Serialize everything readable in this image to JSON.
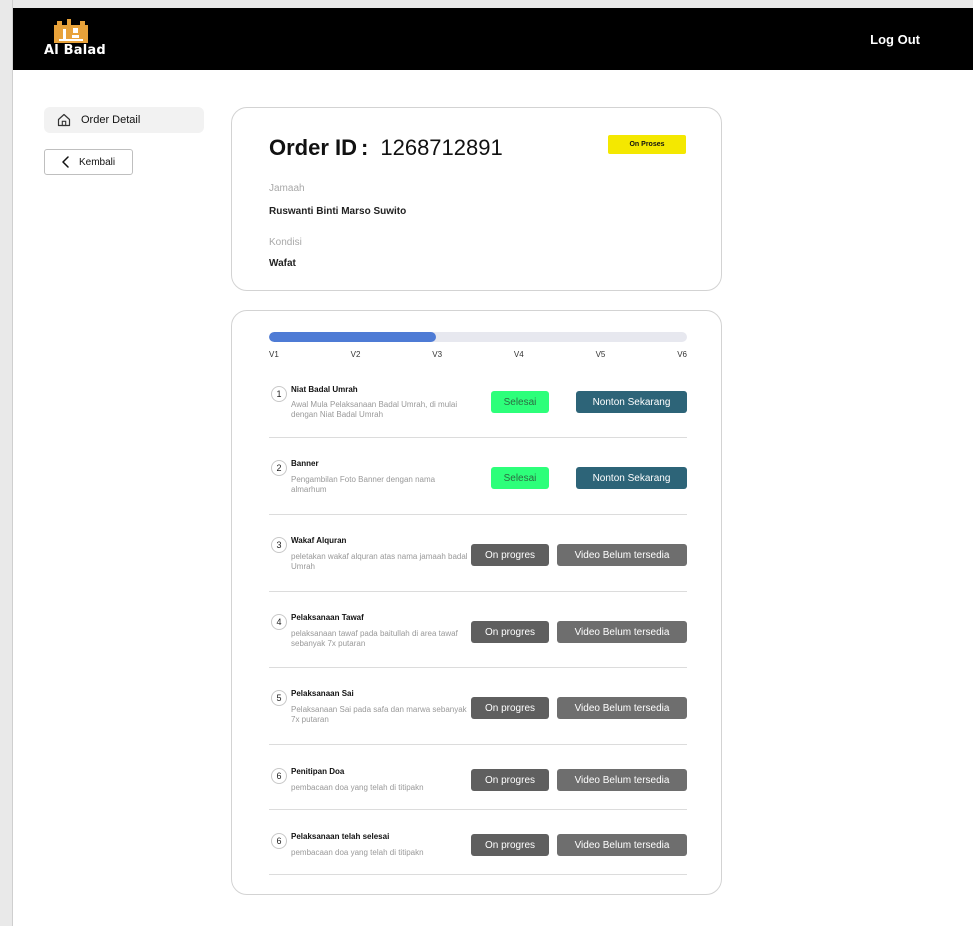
{
  "header": {
    "brand": "Al Balad",
    "logout_label": "Log Out"
  },
  "sidebar": {
    "active_item": {
      "label": "Order Detail",
      "icon": "home-icon"
    },
    "back_button": {
      "label": "Kembali",
      "icon": "chevron-left-icon"
    }
  },
  "order": {
    "id_label": "Order ID",
    "id_value": "1268712891",
    "status": "On Proses",
    "jamaah_label": "Jamaah",
    "jamaah_value": "Ruswanti Binti Marso Suwito",
    "kondisi_label": "Kondisi",
    "kondisi_value": "Wafat"
  },
  "progress": {
    "fraction": 0.4,
    "ticks": [
      "V1",
      "V2",
      "V3",
      "V4",
      "V5",
      "V6"
    ]
  },
  "colors": {
    "status_badge": "#f4e800",
    "done": "#2dff7a",
    "watch": "#2d6478",
    "in_progress": "#5f5f5f",
    "progress_fill": "#4e7bd5"
  },
  "steps": [
    {
      "num": "1",
      "title": "Niat Badal Umrah",
      "desc": "Awal Mula Pelaksanaan Badal Umrah, di mulai dengan Niat Badal Umrah",
      "status": "Selesai",
      "video": "Nonton Sekarang"
    },
    {
      "num": "2",
      "title": "Banner",
      "desc": "Pengambilan Foto Banner dengan nama almarhum",
      "status": "Selesai",
      "video": "Nonton Sekarang"
    },
    {
      "num": "3",
      "title": "Wakaf Alquran",
      "desc": "peletakan wakaf alquran atas nama jamaah badal Umrah",
      "status": "On progres",
      "video": "Video Belum tersedia"
    },
    {
      "num": "4",
      "title": "Pelaksanaan Tawaf",
      "desc": "pelaksanaan tawaf pada baitullah di area tawaf sebanyak 7x putaran",
      "status": "On progres",
      "video": "Video Belum tersedia"
    },
    {
      "num": "5",
      "title": "Pelaksanaan Sai",
      "desc": "Pelaksanaan Sai pada safa dan marwa sebanyak 7x putaran",
      "status": "On progres",
      "video": "Video Belum tersedia"
    },
    {
      "num": "6",
      "title": "Penitipan Doa",
      "desc": "pembacaan doa yang telah di titipakn",
      "status": "On progres",
      "video": "Video Belum tersedia"
    },
    {
      "num": "6",
      "title": "Pelaksanaan telah selesai",
      "desc": "pembacaan doa yang telah di titipakn",
      "status": "On progres",
      "video": "Video Belum tersedia"
    }
  ]
}
